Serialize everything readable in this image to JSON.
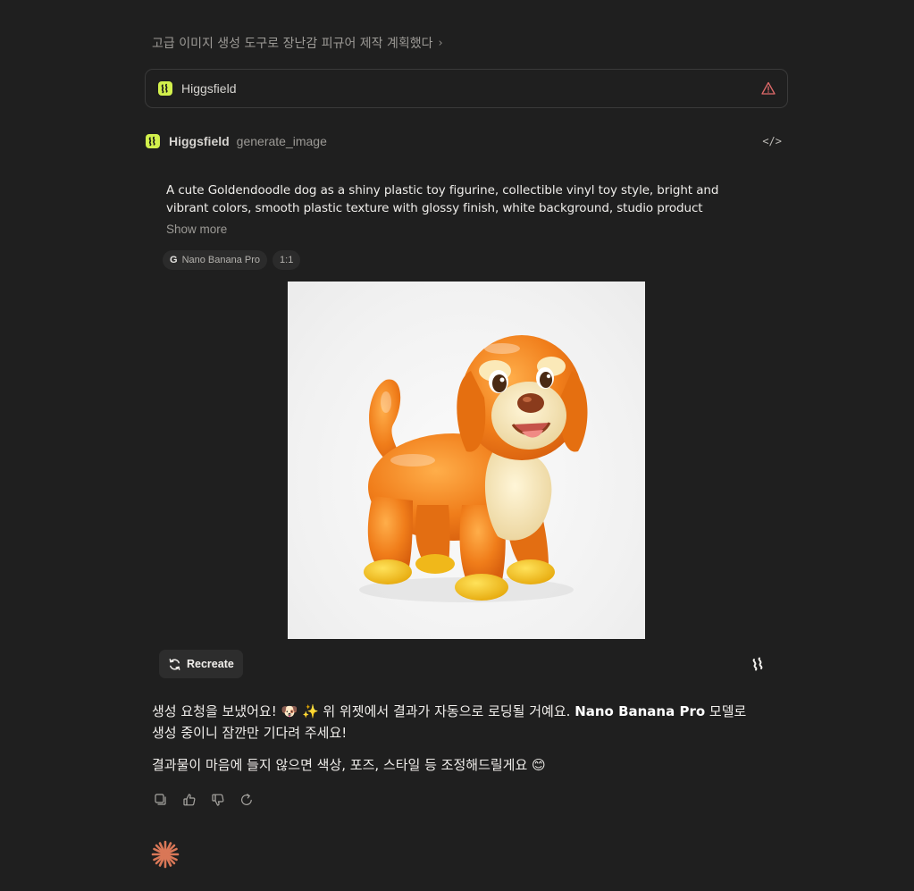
{
  "breadcrumb": {
    "title": "고급 이미지 생성 도구로 장난감 피규어 제작 계획했다",
    "chevron": "›"
  },
  "tool_card": {
    "name": "Higgsfield",
    "icon": "higgsfield-logo",
    "status_icon": "warning-triangle-icon"
  },
  "tool_call": {
    "name": "Higgsfield",
    "function": "generate_image",
    "code_toggle": "</>"
  },
  "prompt": {
    "text": "A cute Goldendoodle dog as a shiny plastic toy figurine, collectible vinyl toy style, bright and vibrant colors, smooth plastic texture with glossy finish, white background, studio product photography, high...",
    "show_more": "Show more"
  },
  "chips": {
    "model": "Nano Banana Pro",
    "model_icon": "G",
    "ratio": "1:1"
  },
  "image": {
    "alt": "Orange Goldendoodle toy figurine",
    "accent_orange": "#f07d1a",
    "cream": "#f3e2b5",
    "yellow": "#f5c21a"
  },
  "recreate_label": "Recreate",
  "message": {
    "line1_pre": "생성 요청을 보냈어요! 🐶 ✨ 위 위젯에서 결과가 자동으로 로딩될 거예요. ",
    "line1_bold": "Nano Banana Pro",
    "line1_post": " 모델로 생성 중이니 잠깐만 기다려 주세요!",
    "line2": "결과물이 마음에 들지 않으면 색상, 포즈, 스타일 등 조정해드릴게요 😊"
  },
  "actions": [
    "copy-icon",
    "thumbs-up-icon",
    "thumbs-down-icon",
    "retry-icon"
  ],
  "colors": {
    "background": "#1f1f1f",
    "higgsfield_green": "#d2f04c",
    "claude_spark": "#d97757"
  }
}
